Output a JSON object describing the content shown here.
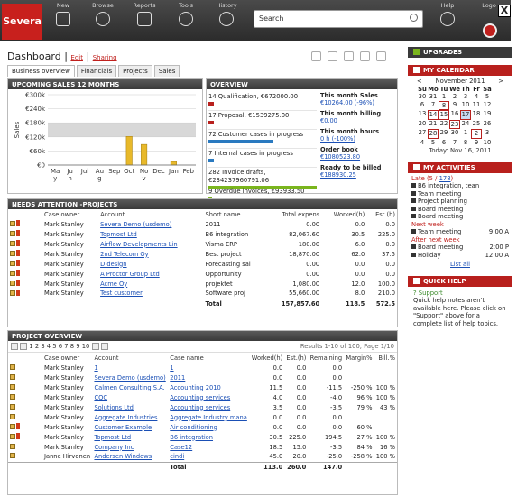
{
  "app": {
    "logo": "Severa",
    "search_placeholder": "Search",
    "close": "X"
  },
  "nav": [
    {
      "label": "New",
      "icon": "plus-icon"
    },
    {
      "label": "Browse",
      "icon": "people-icon"
    },
    {
      "label": "Reports",
      "icon": "chart-icon"
    },
    {
      "label": "Tools",
      "icon": "gear-icon"
    },
    {
      "label": "History",
      "icon": "clock-icon"
    }
  ],
  "nav_right": [
    {
      "label": "Help",
      "icon": "help-icon"
    },
    {
      "label": "Logo",
      "icon": "logout-icon"
    }
  ],
  "dashboard": {
    "title": "Dashboard",
    "edit": "Edit",
    "sharing": "Sharing",
    "sep": "|"
  },
  "tabs": [
    "Business overview",
    "Financials",
    "Projects",
    "Sales"
  ],
  "upcoming": {
    "title": "UPCOMING SALES 12 MONTHS"
  },
  "chart_data": {
    "type": "bar",
    "ylabel": "Sales",
    "ylim": [
      0,
      300000
    ],
    "yticks": [
      "€300k",
      "€240k",
      "€180k",
      "€120k",
      "€60k",
      "€0"
    ],
    "categories": [
      "Ma y",
      "Ju n",
      "Jul",
      "Au g",
      "Sep",
      "Oct",
      "No v",
      "Dec",
      "Jan",
      "Feb"
    ],
    "values": [
      0,
      0,
      0,
      0,
      0,
      122000,
      88000,
      0,
      15000,
      0
    ],
    "band": [
      120000,
      180000
    ]
  },
  "overview": {
    "title": "OVERVIEW",
    "rows": [
      {
        "text": "14 Qualification, €672000.00",
        "bar": 0.05,
        "color": "#b8201d"
      },
      {
        "text": "17 Proposal, €1539275.00",
        "bar": 0.05,
        "color": "#b8201d"
      },
      {
        "text": "72 Customer cases in progress",
        "bar": 0.6,
        "color": "#2a7ac0"
      },
      {
        "text": "7 Internal cases in progress",
        "bar": 0.05,
        "color": "#2a7ac0"
      },
      {
        "text": "282 Invoice drafts, €234237960791.06",
        "bar": 1.0,
        "color": "#7ab51d"
      },
      {
        "text": "9 Overdue invoices, €93933.50",
        "bar": 0.02,
        "color": "#7ab51d"
      }
    ],
    "right": [
      {
        "label": "This month Sales",
        "value": "€10264.00 (-96%)"
      },
      {
        "label": "This month billing",
        "value": "€0.00"
      },
      {
        "label": "This month hours",
        "value": "0 h (-100%)"
      },
      {
        "label": "Order book",
        "value": "€1080523.80"
      },
      {
        "label": "Ready to be billed",
        "value": "€188930.25"
      }
    ]
  },
  "needs": {
    "title": "NEEDS ATTENTION -PROJECTS",
    "headers": [
      "Case owner",
      "Account",
      "Short name",
      "Total expens",
      "Worked(h)",
      "Est.(h)"
    ],
    "rows": [
      [
        "Mark Stanley",
        "Severa Demo (usdemo)",
        "2011",
        "0.00",
        "0.0",
        "0.0"
      ],
      [
        "Mark Stanley",
        "Topmost Ltd",
        "B6 integration",
        "82,067.60",
        "30.5",
        "225.0"
      ],
      [
        "Mark Stanley",
        "Airflow Developments Lin",
        "Visma ERP",
        "180.00",
        "6.0",
        "0.0"
      ],
      [
        "Mark Stanley",
        "2nd Telecom Oy",
        "Best project",
        "18,870.00",
        "62.0",
        "37.5"
      ],
      [
        "Mark Stanley",
        "D design",
        "Forecasting sal",
        "0.00",
        "0.0",
        "0.0"
      ],
      [
        "Mark Stanley",
        "A Proctor Group Ltd",
        "Opportunity",
        "0.00",
        "0.0",
        "0.0"
      ],
      [
        "Mark Stanley",
        "Acme Oy",
        "projektet",
        "1,080.00",
        "12.0",
        "100.0"
      ],
      [
        "Mark Stanley",
        "Test customer",
        "Software proj",
        "55,660.00",
        "8.0",
        "210.0"
      ]
    ],
    "total": {
      "label": "Total",
      "exp": "157,857.60",
      "worked": "118.5",
      "est": "572.5"
    }
  },
  "project": {
    "title": "PROJECT OVERVIEW",
    "pages": "1 2 3 4 5 6 7 8 9 10",
    "results": "Results 1-10 of 100, Page 1/10",
    "headers": [
      "Case owner",
      "Account",
      "Case name",
      "Worked(h)",
      "Est.(h)",
      "Remaining",
      "Margin%",
      "Bill.%"
    ],
    "rows": [
      [
        "Mark Stanley",
        "1",
        "1",
        "0.0",
        "0.0",
        "0.0",
        "",
        ""
      ],
      [
        "Mark Stanley",
        "Severa Demo (usdemo)",
        "2011",
        "0.0",
        "0.0",
        "0.0",
        "",
        ""
      ],
      [
        "Mark Stanley",
        "Calmen Consulting S.A.",
        "Accounting 2010",
        "11.5",
        "0.0",
        "-11.5",
        "-250 %",
        "100 %"
      ],
      [
        "Mark Stanley",
        "CQC",
        "Accounting services",
        "4.0",
        "0.0",
        "-4.0",
        "96 %",
        "100 %"
      ],
      [
        "Mark Stanley",
        "Solutions Ltd",
        "Accounting services",
        "3.5",
        "0.0",
        "-3.5",
        "79 %",
        "43 %"
      ],
      [
        "Mark Stanley",
        "Aggregate Industries",
        "Aggregate Industry mana",
        "0.0",
        "0.0",
        "0.0",
        "",
        ""
      ],
      [
        "Mark Stanley",
        "Customer Example",
        "Air conditioning",
        "0.0",
        "0.0",
        "0.0",
        "60 %",
        ""
      ],
      [
        "Mark Stanley",
        "Topmost Ltd",
        "B6 integration",
        "30.5",
        "225.0",
        "194.5",
        "27 %",
        "100 %"
      ],
      [
        "Mark Stanley",
        "Company Inc",
        "Case12",
        "18.5",
        "15.0",
        "-3.5",
        "84 %",
        "16 %"
      ],
      [
        "Janne Hirvonen",
        "Andersen Windows",
        "cindi",
        "45.0",
        "20.0",
        "-25.0",
        "-258 %",
        "100 %"
      ]
    ],
    "total": {
      "label": "Total",
      "worked": "113.0",
      "est": "260.0",
      "rem": "147.0"
    }
  },
  "sidebar": {
    "upgrades": "UPGRADES",
    "calendar": {
      "title": "MY CALENDAR",
      "month": "November 2011",
      "prev": "<",
      "next": ">",
      "days": [
        "Su",
        "Mo",
        "Tu",
        "We",
        "Th",
        "Fr",
        "Sa"
      ],
      "dates": [
        "30",
        "31",
        "1",
        "2",
        "3",
        "4",
        "5",
        "6",
        "7",
        "8",
        "9",
        "10",
        "11",
        "12",
        "13",
        "14",
        "15",
        "16",
        "17",
        "18",
        "19",
        "20",
        "21",
        "22",
        "23",
        "24",
        "25",
        "26",
        "27",
        "28",
        "29",
        "30",
        "1",
        "2",
        "3",
        "4",
        "5",
        "6",
        "7",
        "8",
        "9",
        "10"
      ],
      "today": "Today: Nov 16, 2011"
    },
    "activities": {
      "title": "MY ACTIVITIES",
      "late": "Late (5 /",
      "late_link": "178",
      "late_close": ")",
      "items": [
        "B6 integration, tean",
        "Team meeting",
        "Project planning",
        "Board meeting",
        "Board meeting"
      ],
      "next_week": "Next week",
      "next_item": "Team meeting",
      "next_time": "9:00 A",
      "after_next": "After next week",
      "after_items": [
        {
          "t": "Board meeting",
          "time": "2:00 P"
        },
        {
          "t": "Holiday",
          "time": "12:00 A"
        }
      ],
      "list_all": "List all"
    },
    "quickhelp": {
      "title": "QUICK HELP",
      "support": "Support",
      "text": "Quick help notes aren't available here. Please click on \"Support\" above for a complete list of help topics."
    }
  }
}
